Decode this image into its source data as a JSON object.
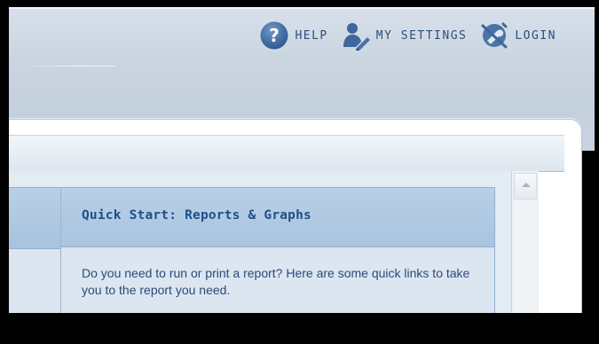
{
  "header": {
    "nav": [
      {
        "label": "HELP",
        "icon": "help-icon"
      },
      {
        "label": "MY SETTINGS",
        "icon": "user-settings-icon"
      },
      {
        "label": "LOGIN",
        "icon": "login-key-icon"
      }
    ]
  },
  "quick_start": {
    "title": "Quick Start: Reports & Graphs",
    "description": "Do you need to run or print a report? Here are some quick links to take you to the report you need."
  },
  "colors": {
    "header_text": "#2e4e7e",
    "title_text": "#1f4f86",
    "icon_blue": "#3d679d"
  }
}
